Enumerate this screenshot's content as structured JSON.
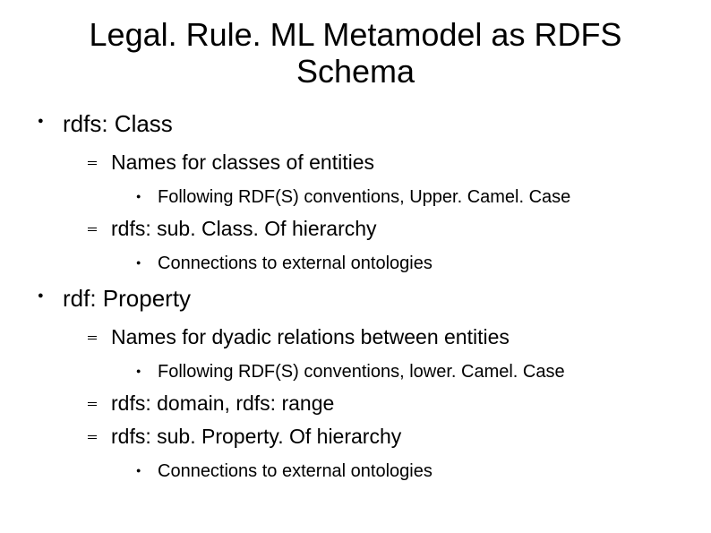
{
  "title": "Legal. Rule. ML Metamodel as RDFS Schema",
  "items": [
    {
      "label": "rdfs: Class",
      "children": [
        {
          "label": "Names for classes of entities",
          "children": [
            {
              "label": "Following RDF(S) conventions, Upper. Camel. Case"
            }
          ]
        },
        {
          "label": "rdfs: sub. Class. Of hierarchy",
          "children": [
            {
              "label": "Connections to external ontologies"
            }
          ]
        }
      ]
    },
    {
      "label": "rdf: Property",
      "children": [
        {
          "label": "Names for dyadic relations between entities",
          "children": [
            {
              "label": "Following RDF(S) conventions, lower. Camel. Case"
            }
          ]
        },
        {
          "label": "rdfs: domain, rdfs: range"
        },
        {
          "label": "rdfs: sub. Property. Of hierarchy",
          "children": [
            {
              "label": "Connections to external ontologies"
            }
          ]
        }
      ]
    }
  ]
}
